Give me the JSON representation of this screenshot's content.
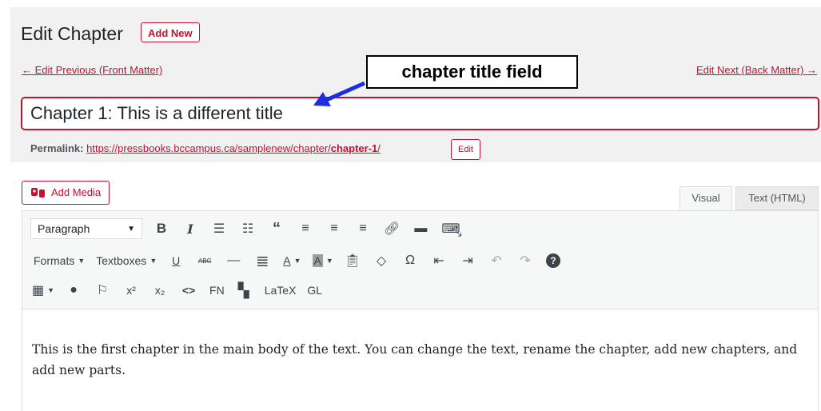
{
  "header": {
    "title": "Edit Chapter",
    "add_new_label": "Add New"
  },
  "nav": {
    "prev_label": "← Edit Previous (Front Matter)",
    "next_label": "Edit Next (Back Matter) →"
  },
  "annotation": {
    "text": "chapter title field"
  },
  "title_field": {
    "value": "Chapter 1: This is a different title"
  },
  "permalink": {
    "label": "Permalink:",
    "url_prefix": "https://pressbooks.bccampus.ca/samplenew/chapter/",
    "slug": "chapter-1",
    "url_suffix": "/",
    "edit_label": "Edit"
  },
  "media": {
    "add_media_label": "Add Media"
  },
  "tabs": {
    "visual": "Visual",
    "text": "Text (HTML)"
  },
  "toolbar": {
    "format_select": "Paragraph",
    "formats_label": "Formats",
    "textboxes_label": "Textboxes",
    "fn_label": "FN",
    "latex_label": "LaTeX",
    "gl_label": "GL",
    "underline_label": "U",
    "text_color_label": "A",
    "bg_color_label": "A",
    "strike_label": "ABC",
    "colors": {
      "annotation_arrow": "#1a2ee6",
      "accent": "#c8102e",
      "bg_color_swatch": "#9e9e9e"
    }
  },
  "content": {
    "text": "This is the first chapter in the main body of the text. You can change the text, rename the chapter, add new chap­ters, and add new parts."
  }
}
